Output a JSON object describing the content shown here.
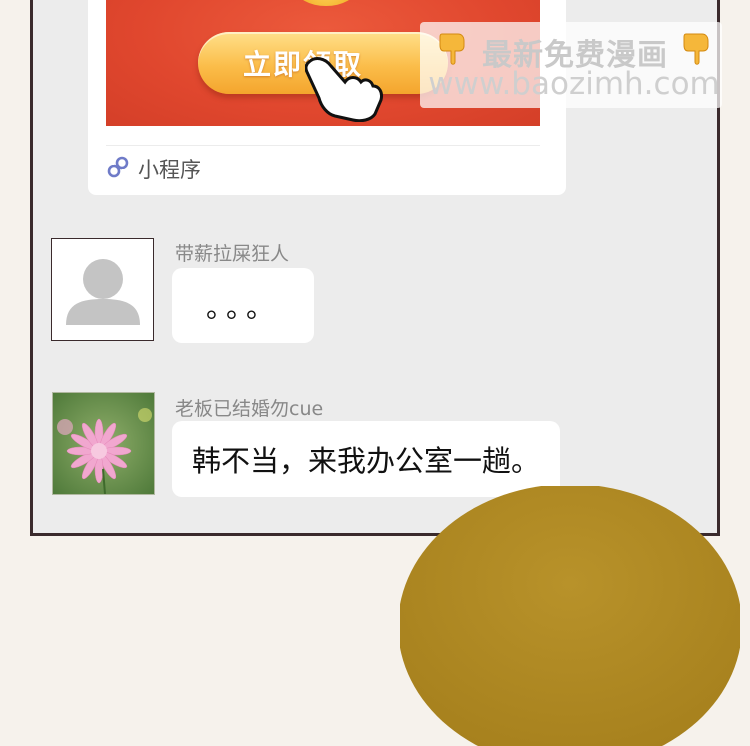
{
  "mini_program_card": {
    "button_label": "立即领取",
    "source_label": "小程序"
  },
  "watermark": {
    "title": "最新免费漫画",
    "url": "www.baozimh.com"
  },
  "messages": [
    {
      "sender": "带薪拉屎狂人",
      "text": "。。。",
      "avatar": "default-avatar"
    },
    {
      "sender": "老板已结婚勿cue",
      "text": "韩不当，来我办公室一趟。",
      "avatar": "flower-avatar"
    }
  ],
  "colors": {
    "banner_red": "#e0472e",
    "button_gold": "#fbbd4a",
    "chat_bg": "#ececec",
    "frame": "#3a2a2c",
    "blob": "#b08a22"
  }
}
